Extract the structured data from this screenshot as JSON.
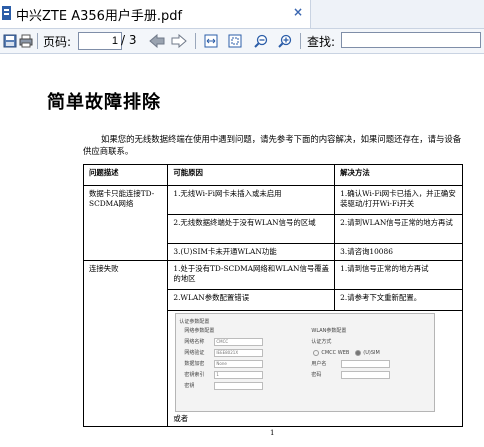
{
  "window": {
    "tab_title": "中兴ZTE  A356用户手册.pdf",
    "tab_close": "×"
  },
  "toolbar": {
    "page_label": "页码:",
    "current_page": "1",
    "total_pages": "/ 3",
    "find_label": "查找:",
    "find_value": ""
  },
  "document": {
    "heading": "简单故障排除",
    "intro": "如果您的无线数据终端在使用中遇到问题，请先参考下面的内容解决，如果问题还存在，请与设备供应商联系。",
    "table": {
      "headers": [
        "问题描述",
        "可能原因",
        "解决方法"
      ],
      "groups": [
        {
          "problem": "数据卡只能连接TD-SCDMA网络",
          "rows": [
            {
              "cause": "1.无线Wi-Fi网卡未插入或未启用",
              "solution": "1.确认Wi-Fi网卡已插入，并正确安装驱动/打开Wi-Fi开关"
            },
            {
              "cause": "2.无线数据终端处于没有WLAN信号的区域",
              "solution": "2.请到WLAN信号正常的地方再试"
            },
            {
              "cause": "3.(U)SIM卡未开通WLAN功能",
              "solution": "3.请咨询10086"
            }
          ]
        },
        {
          "problem": "连接失败",
          "rows": [
            {
              "cause": "1.处于没有TD-SCDMA网络和WLAN信号覆盖的地区",
              "solution": "1.请到信号正常的地方再试"
            },
            {
              "cause": "2.WLAN参数配置错误",
              "solution": "2.请参考下文重新配置。"
            }
          ]
        }
      ],
      "screenshot": {
        "title": "认证参数配置",
        "left_section": "网络参数配置",
        "left_fields": [
          {
            "label": "网络名称",
            "value": "CMCC"
          },
          {
            "label": "网络验证",
            "value": "IEEE8021X"
          },
          {
            "label": "数据加密",
            "value": "None"
          },
          {
            "label": "密钥索引",
            "value": "1"
          },
          {
            "label": "密钥",
            "value": ""
          }
        ],
        "right_section": "WLAN参数配置",
        "auth_label": "认证方式",
        "auth_options": [
          "CMCC WEB",
          "(U)SIM"
        ],
        "right_fields": [
          {
            "label": "用户名",
            "value": ""
          },
          {
            "label": "密码",
            "value": ""
          }
        ]
      },
      "after_screenshot": "或者"
    },
    "page_number": "1"
  },
  "colors": {
    "accent": "#2b5da8",
    "toolbar_bg": "#f3f6fa",
    "titlebar_bg": "#eef2f8"
  }
}
